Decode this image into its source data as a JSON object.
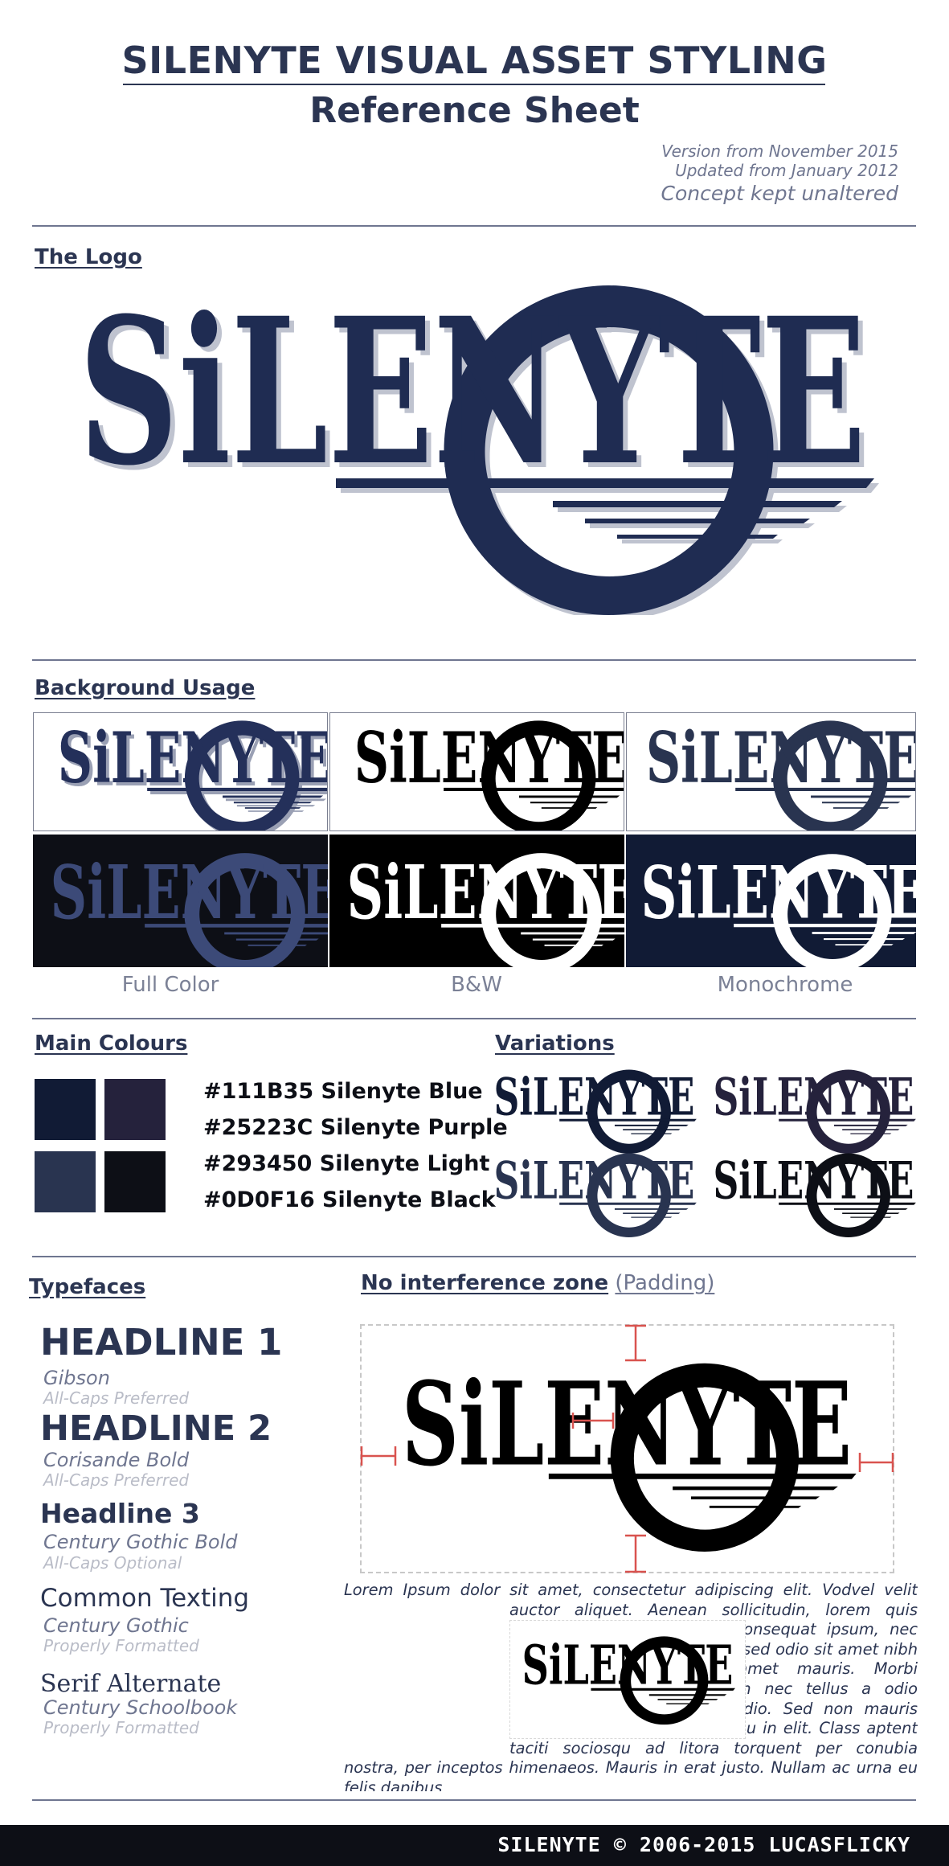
{
  "header": {
    "title": "SILENYTE VISUAL ASSET STYLING",
    "subtitle": "Reference Sheet",
    "version_line": "Version from November 2015",
    "updated_line": "Updated from January 2012",
    "concept_line": "Concept kept unaltered"
  },
  "logo_section": {
    "heading": "The Logo",
    "logo_text": "SiLENYTE"
  },
  "background_usage": {
    "heading": "Background Usage",
    "captions": [
      "Full Color",
      "B&W",
      "Monochrome"
    ]
  },
  "main_colours": {
    "heading": "Main Colours",
    "colors": [
      {
        "hex": "#111B35",
        "label": "#111B35 Silenyte Blue"
      },
      {
        "hex": "#25223C",
        "label": "#25223C Silenyte Purple"
      },
      {
        "hex": "#293450",
        "label": "#293450 Silenyte Light"
      },
      {
        "hex": "#0D0F16",
        "label": "#0D0F16 Silenyte Black"
      }
    ]
  },
  "variations": {
    "heading": "Variations"
  },
  "typefaces": {
    "heading": "Typefaces",
    "items": [
      {
        "sample": "HEADLINE 1",
        "font": "Gibson",
        "note": "All-Caps Preferred"
      },
      {
        "sample": "HEADLINE 2",
        "font": "Corisande Bold",
        "note": "All-Caps Preferred"
      },
      {
        "sample": "Headline 3",
        "font": "Century Gothic Bold",
        "note": "All-Caps Optional"
      },
      {
        "sample": "Common Texting",
        "font": "Century Gothic",
        "note": "Properly Formatted"
      },
      {
        "sample": "Serif Alternate",
        "font": "Century Schoolbook",
        "note": "Properly Formatted"
      }
    ]
  },
  "padding_zone": {
    "heading": "No interference zone",
    "heading_note": "(Padding)"
  },
  "sample_text": "Lorem Ipsum dolor sit amet, consectetur adipiscing elit. Vodvel velit auctor aliquet. Aenean sollicitudin, lorem quis bibendum auctor, nisi elit consequat ipsum, nec sagittis sem nibh id elit. Duis sed odio sit amet nibh vulputate cursus a sit amet mauris. Morbi accumsan ipsum velit. Nam nec tellus a odio tincidunt auctor a ornare odio. Sed non mauris vitae erat consequat auctor eu in elit. Class aptent taciti sociosqu ad litora torquent per conubia nostra, per inceptos himenaeos. Mauris in erat justo. Nullam ac urna eu felis dapibus",
  "footer": {
    "text": "SILENYTE © 2006-2015 LUCASFLICKY"
  },
  "palette": {
    "primary": "#2b3552",
    "rule": "#6f7690",
    "muted": "#7b8196",
    "padding_marker": "#d9534f",
    "dark_bg": "#0d0f16",
    "navy_bg": "#111b35"
  }
}
